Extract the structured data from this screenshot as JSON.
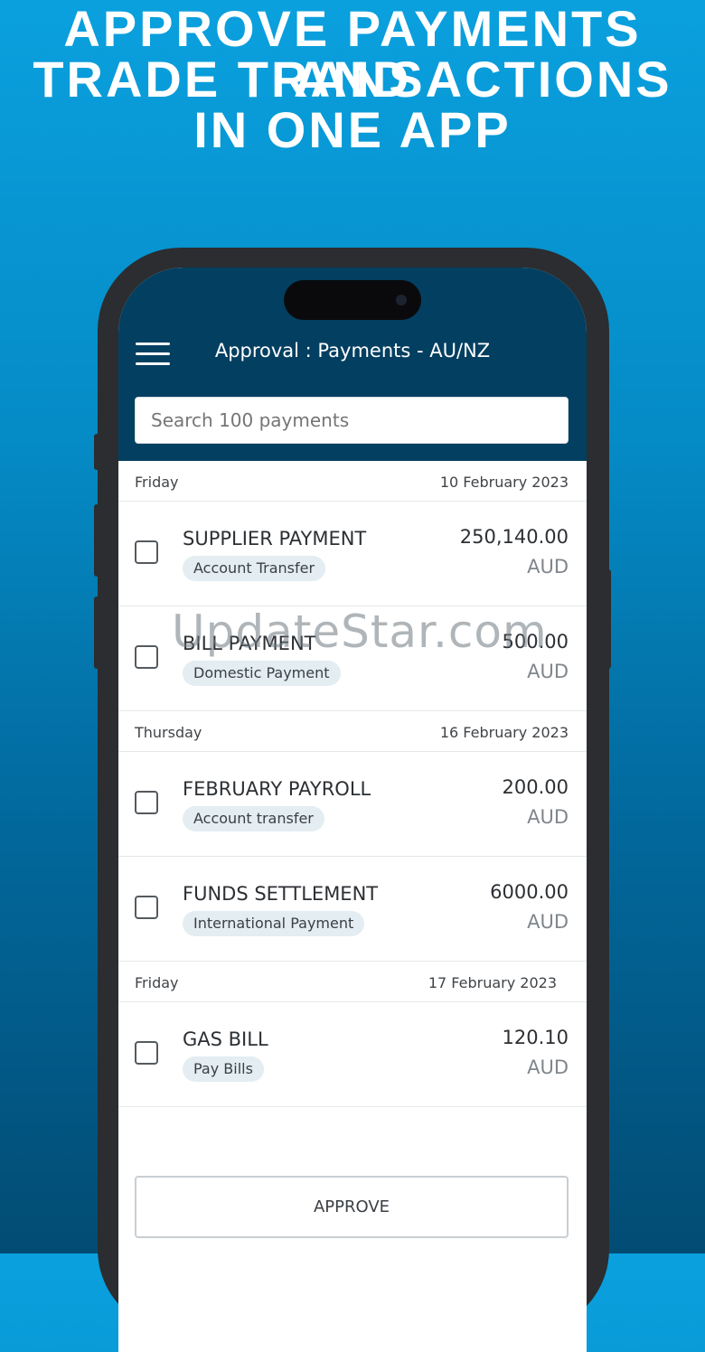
{
  "headline": [
    "APPROVE PAYMENTS AND",
    "TRADE TRANSACTIONS",
    "IN ONE APP"
  ],
  "app": {
    "title": "Approval : Payments - AU/NZ",
    "search_placeholder": "Search 100 payments",
    "approve_label": "APPROVE"
  },
  "groups": [
    {
      "day": "Friday",
      "date": "10 February 2023",
      "items": [
        {
          "name": "SUPPLIER PAYMENT",
          "type": "Account Transfer",
          "amount": "250,140.00",
          "currency": "AUD"
        },
        {
          "name": "BILL PAYMENT",
          "type": "Domestic Payment",
          "amount": "500.00",
          "currency": "AUD"
        }
      ]
    },
    {
      "day": "Thursday",
      "date": "16 February 2023",
      "items": [
        {
          "name": "FEBRUARY PAYROLL",
          "type": "Account transfer",
          "amount": "200.00",
          "currency": "AUD"
        },
        {
          "name": "FUNDS SETTLEMENT",
          "type": "International Payment",
          "amount": "6000.00",
          "currency": "AUD"
        }
      ]
    },
    {
      "day": "Friday",
      "date": "17 February 2023",
      "items": [
        {
          "name": "GAS BILL",
          "type": "Pay Bills",
          "amount": "120.10",
          "currency": "AUD"
        }
      ]
    }
  ],
  "watermark": "UpdateStar.com"
}
